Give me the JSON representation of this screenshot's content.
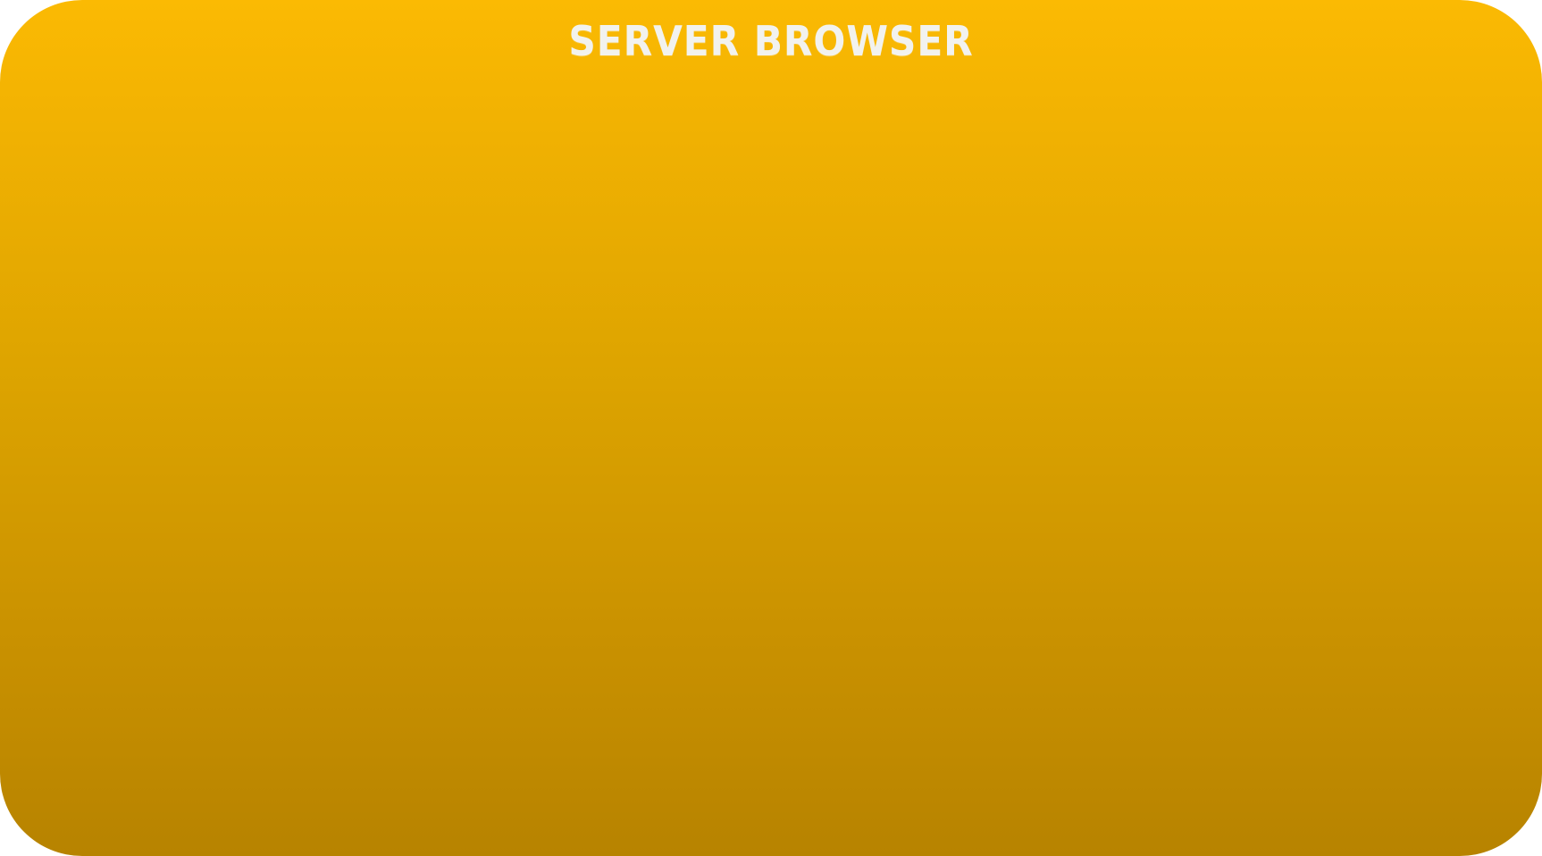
{
  "window": {
    "title": "SERVER BROWSER"
  },
  "colors": {
    "panel_top": "#fbba03",
    "panel_bottom": "#b78300",
    "title_text": "#f2f2ee"
  }
}
